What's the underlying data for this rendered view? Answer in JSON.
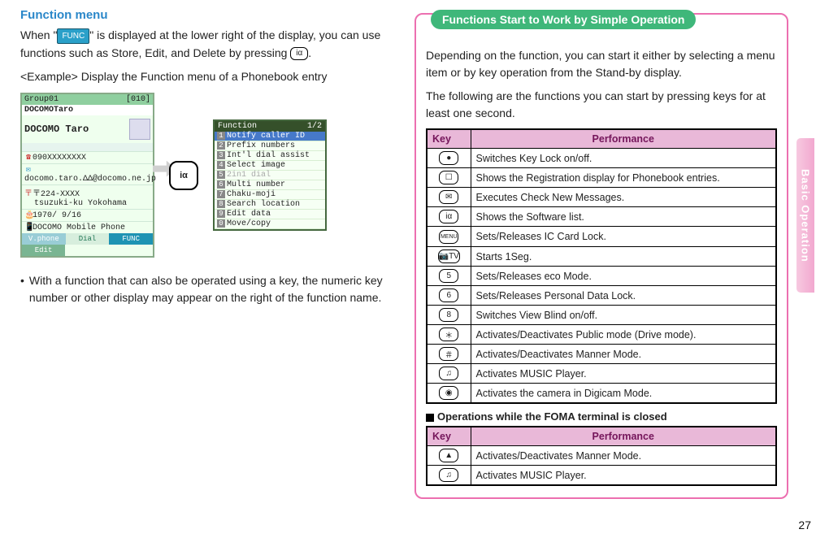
{
  "left": {
    "heading": "Function menu",
    "intro_a": "When \"",
    "intro_b": "\" is displayed at the lower right of the display, you can use functions such as Store, Edit, and Delete by pressing ",
    "intro_c": ".",
    "func_badge": "FUNC",
    "keycap_ir": "iα",
    "example_label": "<Example> Display the Function menu of a Phonebook entry",
    "phone": {
      "group": "Group01",
      "index": "[010]",
      "katakana": "DOCOMOTaro",
      "name": "DOCOMO Taro",
      "tel": "090XXXXXXXX",
      "mail": "docomo.taro.ΔΔ@docomo.ne.jp",
      "zip": "〒224-XXXX",
      "addr": "tsuzuki-ku Yokohama",
      "bday": "1970/ 9/16",
      "carrier": "DOCOMO Mobile Phone",
      "sk_vphone": "V.phone",
      "sk_edit": "Edit",
      "sk_dial": "Dial",
      "sk_func": "FUNC"
    },
    "popup": {
      "title": "Function",
      "page": "1/2",
      "items": [
        "Notify caller ID",
        "Prefix numbers",
        "Int'l dial assist",
        "Select image",
        "2in1 dial",
        "Multi number",
        "Chaku-moji",
        "Search location",
        "Edit data",
        "Move/copy"
      ],
      "grayed": [
        4
      ]
    },
    "note": "With a function that can also be operated using a key, the numeric key number or other display may appear on the right of the function name."
  },
  "right": {
    "pill": "Functions Start to Work by Simple Operation",
    "intro1": "Depending on the function, you can start it either by selecting a menu item or by key operation from the Stand-by display.",
    "intro2": "The following are the functions you can start by pressing keys for at least one second.",
    "th_key": "Key",
    "th_perf": "Performance",
    "rows": [
      {
        "k": "●",
        "p": "Switches Key Lock on/off."
      },
      {
        "k": "☐",
        "p": "Shows the Registration display for Phonebook entries."
      },
      {
        "k": "✉",
        "p": "Executes Check New Messages."
      },
      {
        "k": "iα",
        "p": "Shows the Software list."
      },
      {
        "k": "MENU",
        "p": "Sets/Releases IC Card Lock."
      },
      {
        "k": "📷TV",
        "p": "Starts 1Seg."
      },
      {
        "k": "5",
        "p": "Sets/Releases eco Mode."
      },
      {
        "k": "6",
        "p": "Sets/Releases Personal Data Lock."
      },
      {
        "k": "8",
        "p": "Switches View Blind on/off."
      },
      {
        "k": "＊",
        "p": "Activates/Deactivates Public mode (Drive mode)."
      },
      {
        "k": "＃",
        "p": "Activates/Deactivates Manner Mode."
      },
      {
        "k": "♫",
        "p": "Activates MUSIC Player."
      },
      {
        "k": "◉",
        "p": "Activates the camera in Digicam Mode."
      }
    ],
    "closed_heading": "Operations while the FOMA terminal is closed",
    "rows2": [
      {
        "k": "▲",
        "p": "Activates/Deactivates Manner Mode."
      },
      {
        "k": "♫",
        "p": "Activates MUSIC Player."
      }
    ]
  },
  "sidetab": "Basic Operation",
  "pagenum": "27"
}
